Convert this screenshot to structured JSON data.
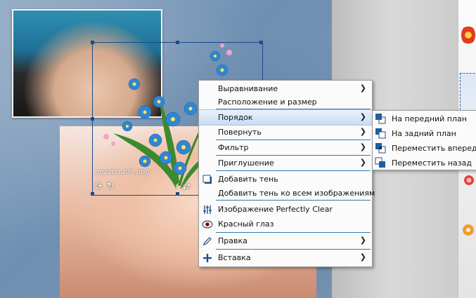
{
  "canvas": {
    "watermark": "nezabud09.png"
  },
  "context_menu": {
    "items": [
      {
        "label": "Выравнивание",
        "has_submenu": true,
        "icon": ""
      },
      {
        "label": "Расположение и размер",
        "has_submenu": false,
        "icon": ""
      },
      {
        "label": "Порядок",
        "has_submenu": true,
        "icon": "",
        "active": true
      },
      {
        "label": "Повернуть",
        "has_submenu": true,
        "icon": ""
      },
      {
        "label": "Фильтр",
        "has_submenu": true,
        "icon": ""
      },
      {
        "label": "Приглушение",
        "has_submenu": true,
        "icon": ""
      },
      {
        "label": "Добавить тень",
        "has_submenu": false,
        "icon": "shadow-icon"
      },
      {
        "label": "Добавить тень ко всем изображениям",
        "has_submenu": false,
        "icon": ""
      },
      {
        "label": "Изображение Perfectly Clear",
        "has_submenu": false,
        "icon": "sliders-icon"
      },
      {
        "label": "Красный глаз",
        "has_submenu": false,
        "icon": "eye-icon"
      },
      {
        "label": "Правка",
        "has_submenu": true,
        "icon": "pencil-icon"
      },
      {
        "label": "Вставка",
        "has_submenu": true,
        "icon": "plus-icon"
      }
    ],
    "arrow_glyph": "❯"
  },
  "order_submenu": {
    "items": [
      {
        "label": "На передний план",
        "icon": "bring-to-front-icon"
      },
      {
        "label": "На задний план",
        "icon": "send-to-back-icon"
      },
      {
        "label": "Переместить вперед",
        "icon": "bring-forward-icon"
      },
      {
        "label": "Переместить назад",
        "icon": "send-backward-icon"
      }
    ]
  },
  "colors": {
    "accent": "#1f6fb0",
    "separator": "#2f7ab0",
    "selection": "#1c4a8a",
    "highlight": "#c9ddf3"
  }
}
